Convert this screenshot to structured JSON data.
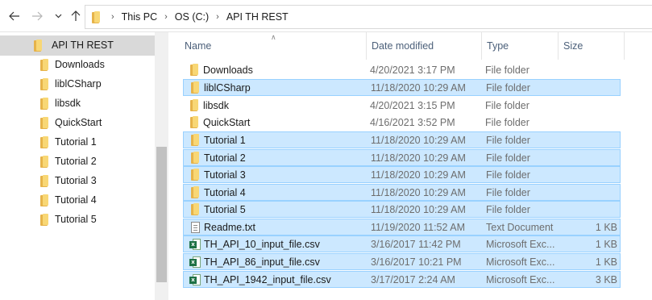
{
  "nav_buttons": {
    "back_icon": "arrow-left-icon",
    "forward_icon": "arrow-right-icon",
    "recent_icon": "chevron-down-icon",
    "up_icon": "arrow-up-icon"
  },
  "breadcrumb": [
    "This PC",
    "OS (C:)",
    "API TH REST"
  ],
  "nav_pane": {
    "selected": "API TH REST",
    "items": [
      "Downloads",
      "liblCSharp",
      "libsdk",
      "QuickStart",
      "Tutorial 1",
      "Tutorial 2",
      "Tutorial 3",
      "Tutorial 4",
      "Tutorial 5"
    ]
  },
  "columns": {
    "name": "Name",
    "date": "Date modified",
    "type": "Type",
    "size": "Size"
  },
  "files": [
    {
      "name": "Downloads",
      "date": "4/20/2021 3:17 PM",
      "type": "File folder",
      "size": "",
      "icon": "folder",
      "selected": false
    },
    {
      "name": "liblCSharp",
      "date": "11/18/2020 10:29 AM",
      "type": "File folder",
      "size": "",
      "icon": "folder",
      "selected": true
    },
    {
      "name": "libsdk",
      "date": "4/20/2021 3:15 PM",
      "type": "File folder",
      "size": "",
      "icon": "folder",
      "selected": false
    },
    {
      "name": "QuickStart",
      "date": "4/16/2021 3:52 PM",
      "type": "File folder",
      "size": "",
      "icon": "folder",
      "selected": false
    },
    {
      "name": "Tutorial 1",
      "date": "11/18/2020 10:29 AM",
      "type": "File folder",
      "size": "",
      "icon": "folder",
      "selected": true
    },
    {
      "name": "Tutorial 2",
      "date": "11/18/2020 10:29 AM",
      "type": "File folder",
      "size": "",
      "icon": "folder",
      "selected": true
    },
    {
      "name": "Tutorial 3",
      "date": "11/18/2020 10:29 AM",
      "type": "File folder",
      "size": "",
      "icon": "folder",
      "selected": true
    },
    {
      "name": "Tutorial 4",
      "date": "11/18/2020 10:29 AM",
      "type": "File folder",
      "size": "",
      "icon": "folder",
      "selected": true
    },
    {
      "name": "Tutorial 5",
      "date": "11/18/2020 10:29 AM",
      "type": "File folder",
      "size": "",
      "icon": "folder",
      "selected": true
    },
    {
      "name": "Readme.txt",
      "date": "11/19/2020 11:52 AM",
      "type": "Text Document",
      "size": "1 KB",
      "icon": "text",
      "selected": true
    },
    {
      "name": "TH_API_10_input_file.csv",
      "date": "3/16/2017 11:42 PM",
      "type": "Microsoft Exc...",
      "size": "1 KB",
      "icon": "csv",
      "selected": true
    },
    {
      "name": "TH_API_86_input_file.csv",
      "date": "3/16/2017 10:21 PM",
      "type": "Microsoft Exc...",
      "size": "1 KB",
      "icon": "csv",
      "selected": true
    },
    {
      "name": "TH_API_1942_input_file.csv",
      "date": "3/17/2017 2:24 AM",
      "type": "Microsoft Exc...",
      "size": "3 KB",
      "icon": "csv",
      "selected": true
    }
  ],
  "colors": {
    "selection_fill": "#cce8ff",
    "selection_border": "#99d1ff",
    "nav_selection": "#d9d9d9",
    "header_text": "#4c607a",
    "folder_front": "#f8d775",
    "folder_back": "#e6b34a",
    "excel_green": "#1e7145"
  }
}
